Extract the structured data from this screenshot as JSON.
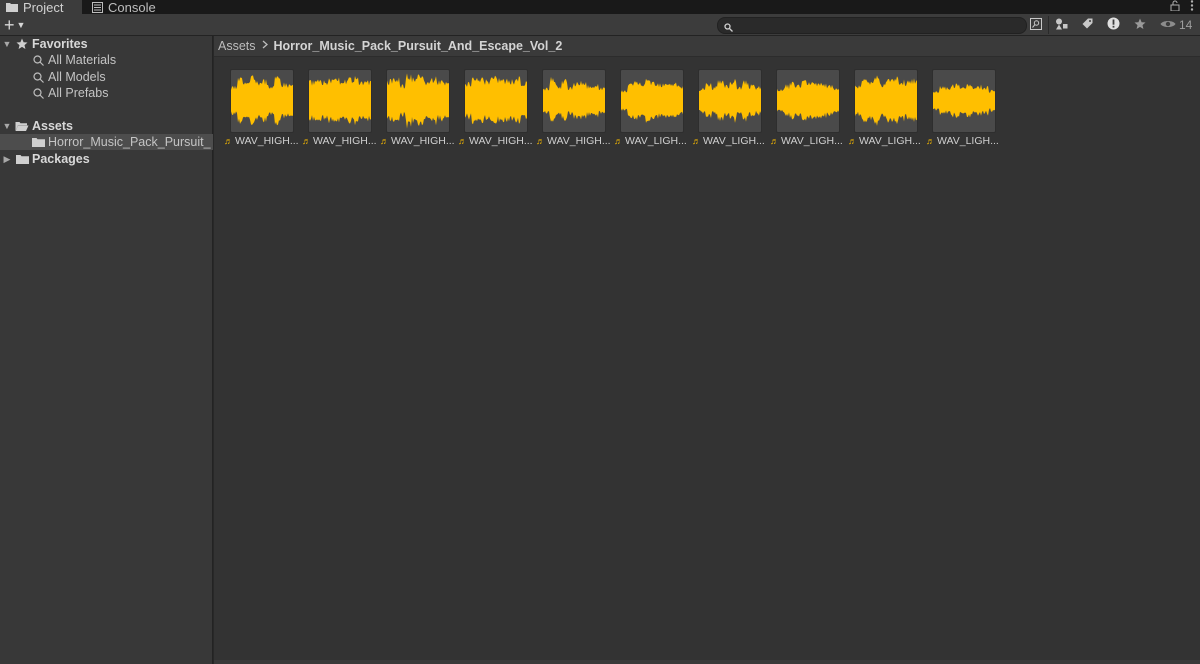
{
  "tabs": [
    {
      "label": "Project",
      "icon": "folder-icon"
    },
    {
      "label": "Console",
      "icon": "console-icon"
    }
  ],
  "window_controls": {
    "lock_icon": "lock-icon",
    "menu_icon": "kebab-menu-icon"
  },
  "toolbar": {
    "create_label": "+",
    "search": {
      "placeholder": "",
      "value": ""
    },
    "hidden_count": "14"
  },
  "sidebar": {
    "favorites": {
      "label": "Favorites",
      "items": [
        "All Materials",
        "All Models",
        "All Prefabs"
      ]
    },
    "assets": {
      "label": "Assets",
      "children": [
        "Horror_Music_Pack_Pursuit_"
      ]
    },
    "packages": {
      "label": "Packages"
    }
  },
  "breadcrumb": {
    "root": "Assets",
    "current": "Horror_Music_Pack_Pursuit_And_Escape_Vol_2"
  },
  "assets": [
    {
      "label": "WAV_HIGH..."
    },
    {
      "label": "WAV_HIGH..."
    },
    {
      "label": "WAV_HIGH..."
    },
    {
      "label": "WAV_HIGH..."
    },
    {
      "label": "WAV_HIGH..."
    },
    {
      "label": "WAV_LIGH..."
    },
    {
      "label": "WAV_LIGH..."
    },
    {
      "label": "WAV_LIGH..."
    },
    {
      "label": "WAV_LIGH..."
    },
    {
      "label": "WAV_LIGH..."
    }
  ],
  "colors": {
    "waveform": "#ffbf00",
    "thumb_bg": "#4a4a4a",
    "panel_bg": "#333333",
    "sidebar_bg": "#383838"
  }
}
